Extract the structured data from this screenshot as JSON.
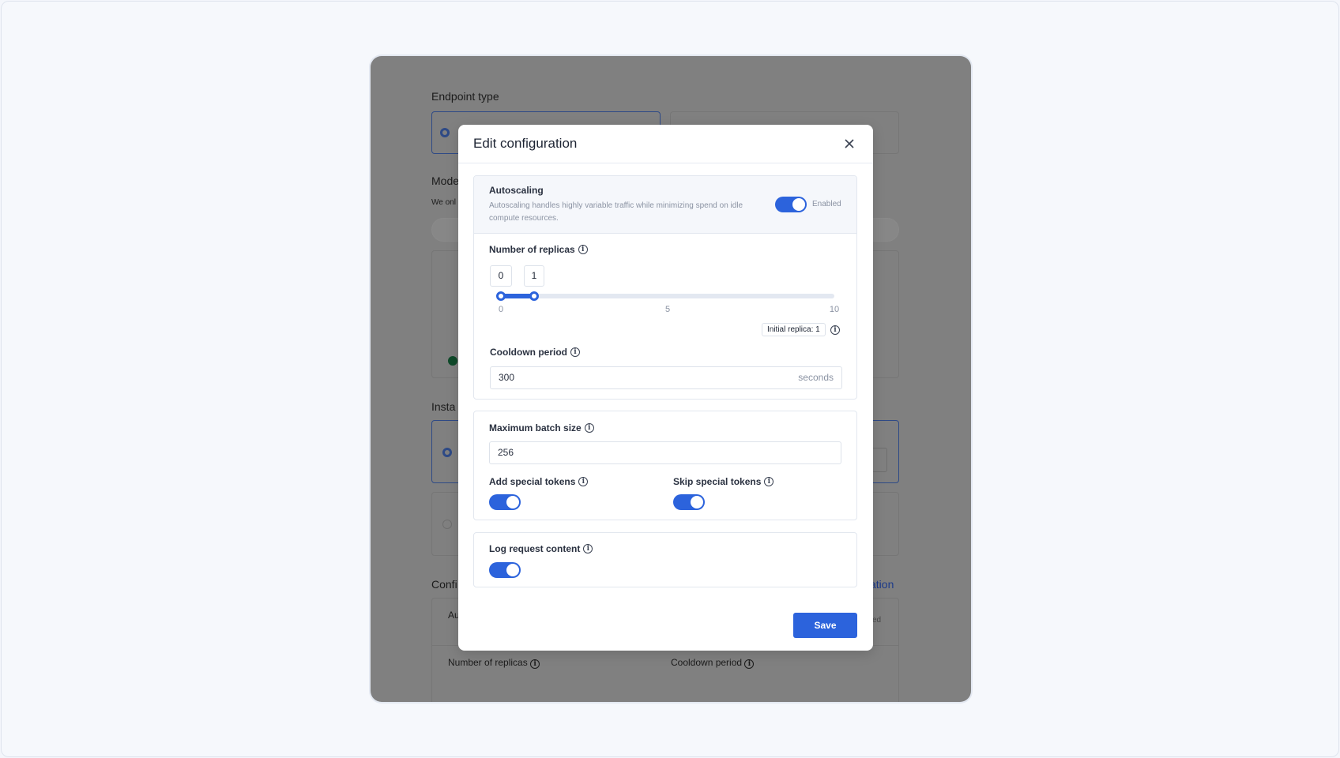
{
  "background": {
    "endpoint_type": "Endpoint type",
    "mode": "Mode",
    "we_only": "We onl",
    "instance": "Insta",
    "config": "Confi",
    "config_link": "ation",
    "auto_abbr": "Au",
    "enabled_frag": "ed",
    "number_of_replicas": "Number of replicas",
    "cooldown_period": "Cooldown period"
  },
  "modal": {
    "title": "Edit configuration",
    "autoscaling": {
      "title": "Autoscaling",
      "description": "Autoscaling handles highly variable traffic while minimizing spend on idle compute resources.",
      "enabled": true,
      "status": "Enabled"
    },
    "replicas": {
      "label": "Number of replicas",
      "min_value": "0",
      "max_value": "1",
      "range_min": 0,
      "range_max": 10,
      "ticks": [
        "0",
        "5",
        "10"
      ],
      "initial_replica": "Initial replica: 1"
    },
    "cooldown": {
      "label": "Cooldown period",
      "value": "300",
      "unit": "seconds"
    },
    "batch": {
      "label": "Maximum batch size",
      "value": "256"
    },
    "add_special_tokens": {
      "label": "Add special tokens",
      "enabled": true
    },
    "skip_special_tokens": {
      "label": "Skip special tokens",
      "enabled": true
    },
    "log_request": {
      "label": "Log request content",
      "enabled": true
    },
    "save": "Save"
  },
  "colors": {
    "accent": "#2c63dc",
    "overlay": "#808080"
  }
}
